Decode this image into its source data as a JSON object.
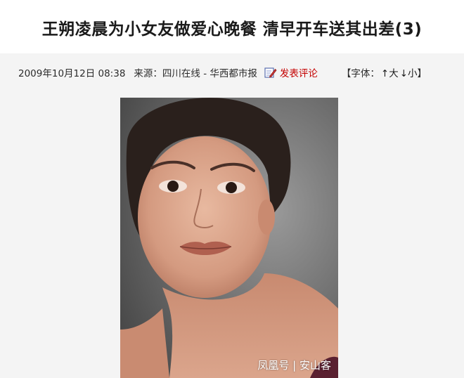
{
  "article": {
    "title": "王朔凌晨为小女友做爱心晚餐 清早开车送其出差(3)"
  },
  "meta": {
    "datetime": "2009年10月12日 08:38",
    "source_label": "来源：",
    "source": "四川在线 - 华西都市报",
    "comment_link": "发表评论",
    "font_label": "【字体：",
    "font_large": "↑大",
    "font_small": "↓小",
    "font_close": "】"
  },
  "photo": {
    "description_icon": "portrait-photo"
  },
  "watermark": {
    "text": "凤凰号 | 安山客"
  },
  "colors": {
    "comment_link": "#c40000",
    "title": "#1a1a1a",
    "background": "#f4f4f4"
  }
}
